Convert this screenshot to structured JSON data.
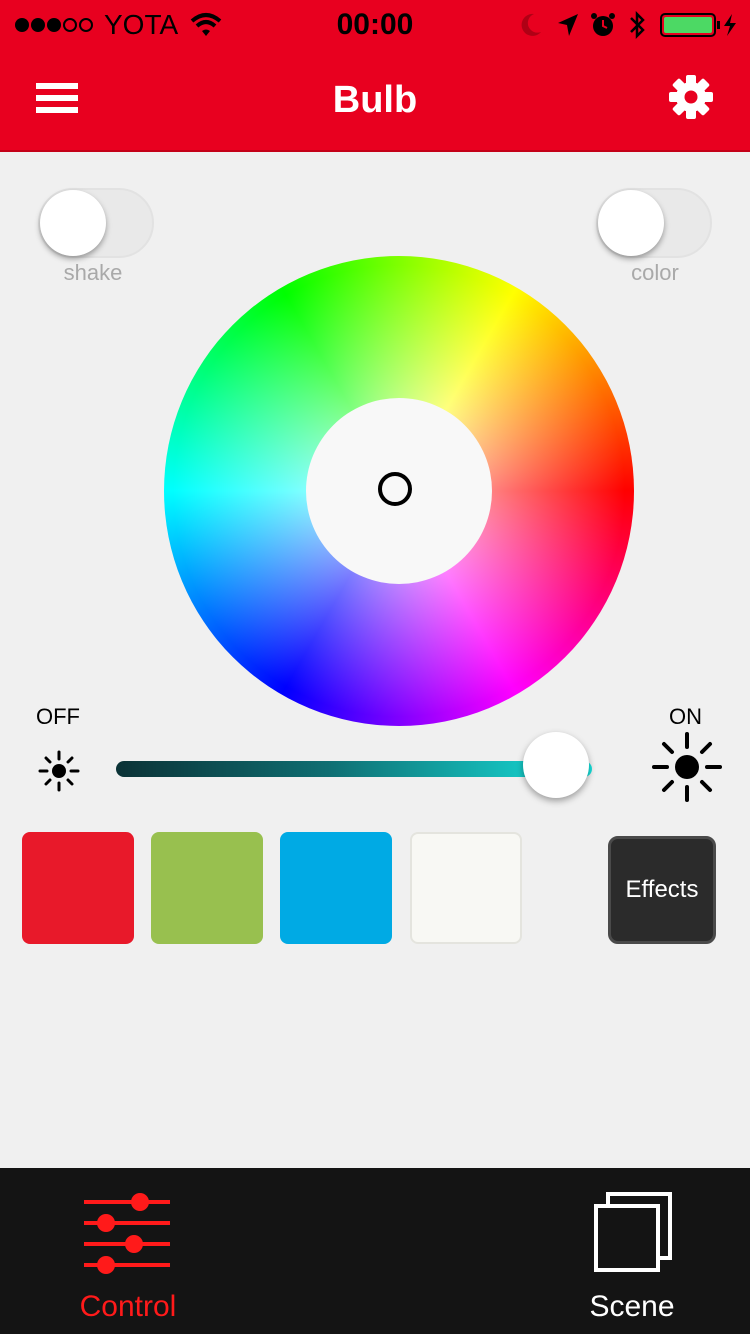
{
  "status_bar": {
    "carrier": "YOTA",
    "time": "00:00"
  },
  "nav": {
    "title": "Bulb"
  },
  "toggles": {
    "shake_label": "shake",
    "color_label": "color"
  },
  "brightness": {
    "off_label": "OFF",
    "on_label": "ON",
    "level": 0.92
  },
  "swatches": [
    {
      "name": "red",
      "color": "#e8192a"
    },
    {
      "name": "green",
      "color": "#98c04f"
    },
    {
      "name": "blue",
      "color": "#00aae4"
    },
    {
      "name": "white",
      "color": "#f8f8f4"
    }
  ],
  "effects": {
    "label": "Effects"
  },
  "tabs": {
    "control_label": "Control",
    "scene_label": "Scene",
    "active_color": "#ff1a1a",
    "inactive_color": "#ffffff"
  }
}
